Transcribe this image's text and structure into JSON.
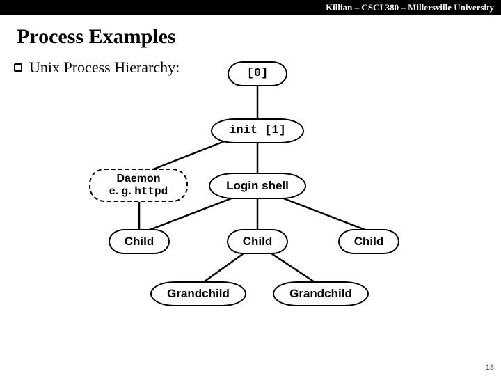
{
  "header": "Killian – CSCI 380 – Millersville University",
  "title": "Process Examples",
  "bullet": "Unix Process Hierarchy:",
  "nodes": {
    "root": "[0]",
    "init": "init [1]",
    "daemon_l1": "Daemon",
    "daemon_l2_a": "e. g. ",
    "daemon_l2_b": "httpd",
    "login": "Login shell",
    "child1": "Child",
    "child2": "Child",
    "child3": "Child",
    "gc1": "Grandchild",
    "gc2": "Grandchild"
  },
  "page": "18"
}
